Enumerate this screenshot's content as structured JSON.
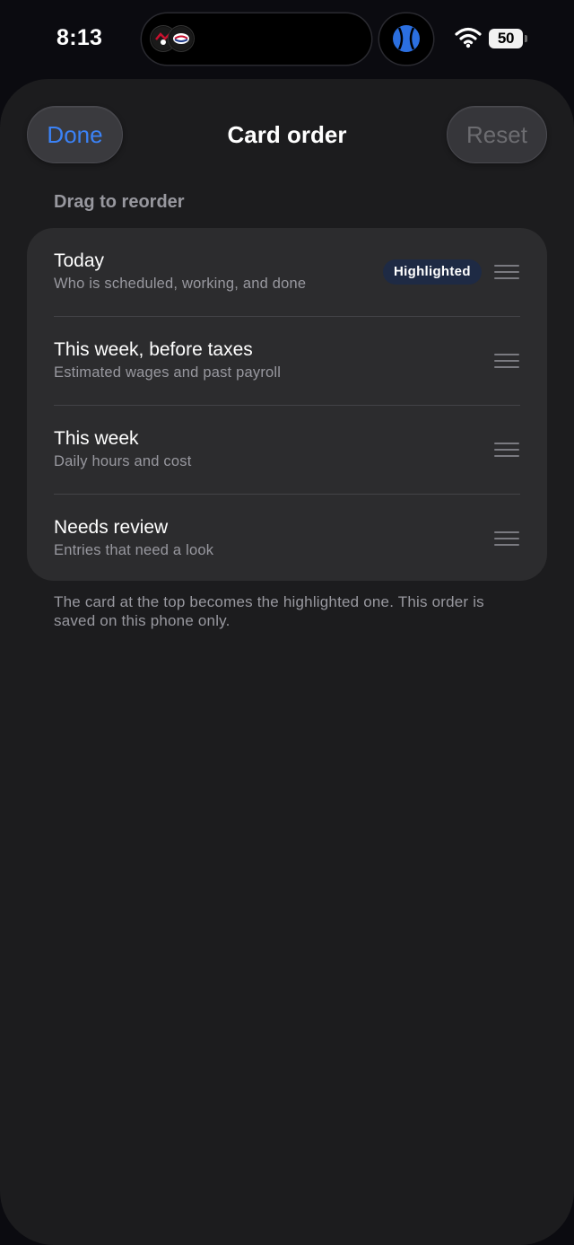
{
  "status_bar": {
    "time": "8:13",
    "battery_level": "50"
  },
  "header": {
    "done_label": "Done",
    "title": "Card order",
    "reset_label": "Reset"
  },
  "section_label": "Drag to reorder",
  "cards": [
    {
      "title": "Today",
      "subtitle": "Who is scheduled, working, and done",
      "badge": "Highlighted"
    },
    {
      "title": "This week, before taxes",
      "subtitle": "Estimated wages and past payroll"
    },
    {
      "title": "This week",
      "subtitle": "Daily hours and cost"
    },
    {
      "title": "Needs review",
      "subtitle": "Entries that need a look"
    }
  ],
  "footer_note": "The card at the top becomes the highlighted one. This order is saved on this phone only.",
  "colors": {
    "accent": "#3b82f6",
    "sheet_background": "#1c1c1e",
    "card_background": "#2c2c2e",
    "badge_background": "#1e2a44"
  }
}
